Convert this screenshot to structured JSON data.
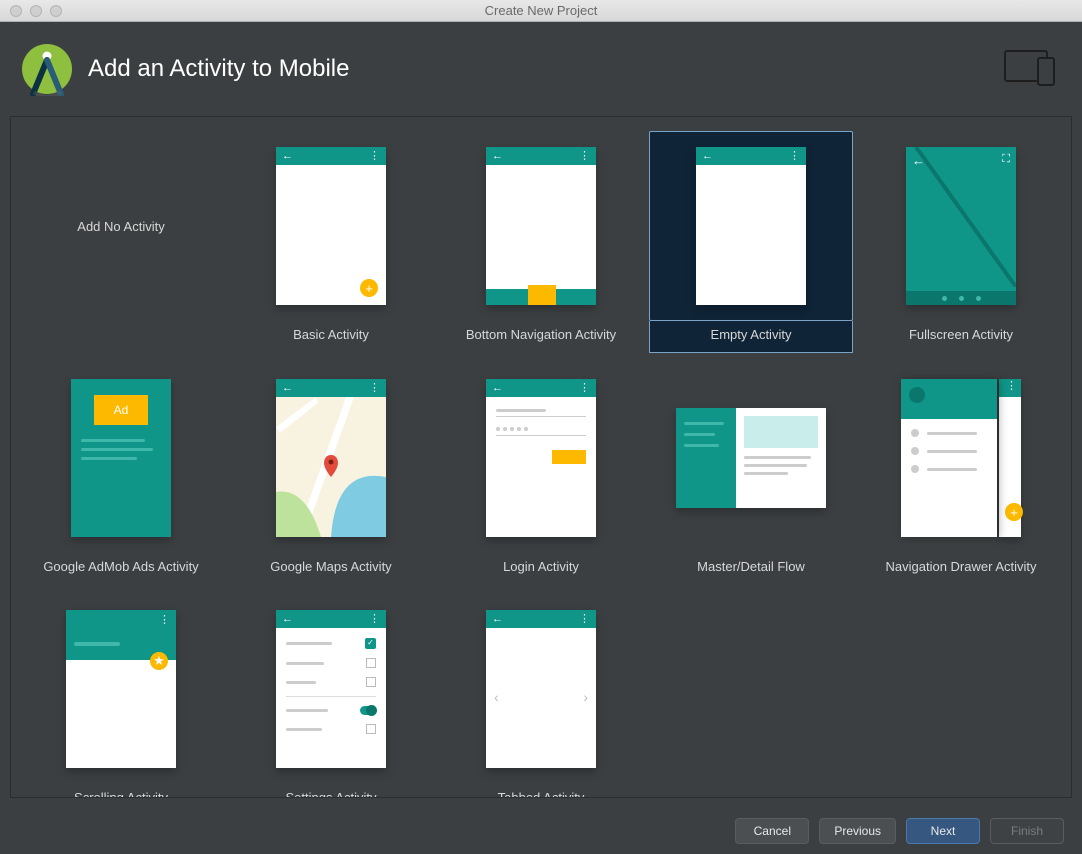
{
  "window": {
    "title": "Create New Project"
  },
  "header": {
    "title": "Add an Activity to Mobile"
  },
  "selected_index": 3,
  "templates": [
    {
      "label": "Add No Activity",
      "kind": "none"
    },
    {
      "label": "Basic Activity",
      "kind": "basic"
    },
    {
      "label": "Bottom Navigation Activity",
      "kind": "bottom_nav"
    },
    {
      "label": "Empty Activity",
      "kind": "empty"
    },
    {
      "label": "Fullscreen Activity",
      "kind": "fullscreen"
    },
    {
      "label": "Google AdMob Ads Activity",
      "kind": "admob"
    },
    {
      "label": "Google Maps Activity",
      "kind": "maps"
    },
    {
      "label": "Login Activity",
      "kind": "login"
    },
    {
      "label": "Master/Detail Flow",
      "kind": "master_detail"
    },
    {
      "label": "Navigation Drawer Activity",
      "kind": "nav_drawer"
    },
    {
      "label": "Scrolling Activity",
      "kind": "scrolling"
    },
    {
      "label": "Settings Activity",
      "kind": "settings"
    },
    {
      "label": "Tabbed Activity",
      "kind": "tabbed"
    }
  ],
  "footer": {
    "cancel": "Cancel",
    "previous": "Previous",
    "next": "Next",
    "finish": "Finish"
  },
  "colors": {
    "teal": "#0f9688",
    "amber": "#fdb900",
    "bg": "#3b3f41",
    "selected": "#0f2437"
  }
}
